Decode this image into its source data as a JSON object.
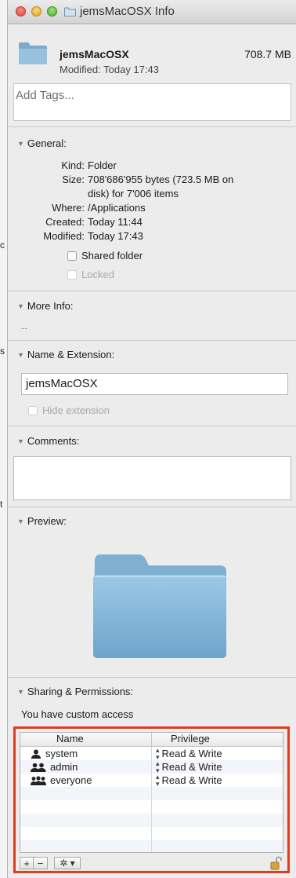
{
  "window": {
    "title": "jemsMacOSX Info"
  },
  "header": {
    "name": "jemsMacOSX",
    "size": "708.7 MB",
    "modified": "Modified: Today 17:43"
  },
  "tags": {
    "placeholder": "Add Tags..."
  },
  "general": {
    "heading": "General:",
    "rows": [
      {
        "label": "Kind:",
        "value": "Folder"
      },
      {
        "label": "Size:",
        "value": "708'686'955 bytes (723.5 MB on"
      },
      {
        "label": "",
        "value": "disk) for 7'006 items"
      },
      {
        "label": "Where:",
        "value": "/Applications"
      },
      {
        "label": "Created:",
        "value": "Today 11:44"
      },
      {
        "label": "Modified:",
        "value": "Today 17:43"
      }
    ],
    "shared_folder": "Shared folder",
    "locked": "Locked"
  },
  "more_info": {
    "heading": "More Info:",
    "value": "--"
  },
  "name_ext": {
    "heading": "Name & Extension:",
    "name": "jemsMacOSX",
    "hide_extension": "Hide extension"
  },
  "comments": {
    "heading": "Comments:"
  },
  "preview": {
    "heading": "Preview:"
  },
  "sharing": {
    "heading": "Sharing & Permissions:",
    "access": "You have custom access",
    "columns": {
      "name": "Name",
      "privilege": "Privilege"
    },
    "rows": [
      {
        "name": "system",
        "privilege": "Read & Write",
        "icon": "single-user-icon"
      },
      {
        "name": "admin",
        "privilege": "Read & Write",
        "icon": "group-icon"
      },
      {
        "name": "everyone",
        "privilege": "Read & Write",
        "icon": "everyone-icon"
      }
    ],
    "add_label": "+",
    "remove_label": "−",
    "gear_label": "✲ ▾"
  },
  "left_edge": {
    "mark_1": "c",
    "mark_2": "s",
    "mark_3": "t"
  },
  "colors": {
    "highlight_frame": "#e13b1e",
    "folder_blue": "#8ab8d8"
  }
}
